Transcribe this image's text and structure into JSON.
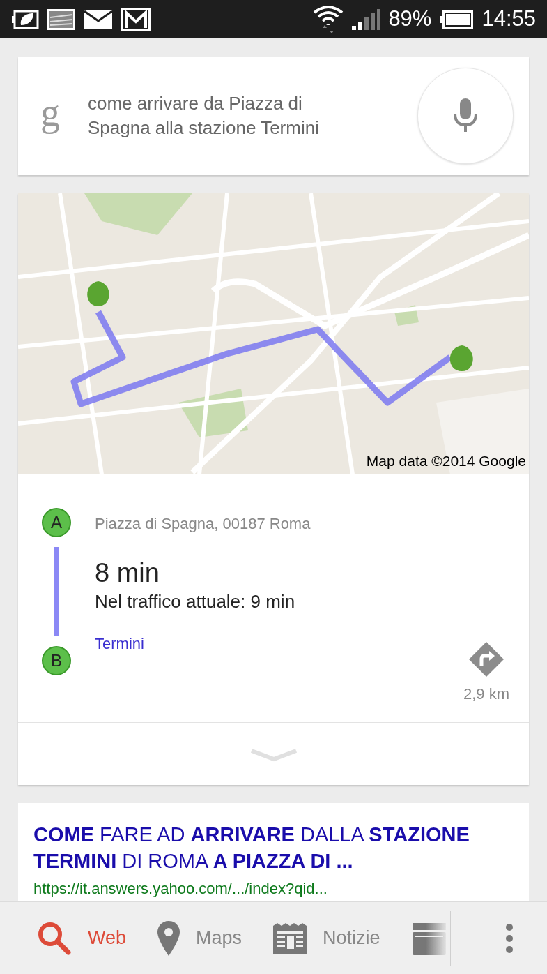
{
  "status_bar": {
    "battery": "89%",
    "time": "14:55"
  },
  "search": {
    "logo": "g",
    "query": "come arrivare da Piazza di Spagna alla stazione Termini"
  },
  "directions": {
    "map_attribution": "Map data ©2014 Google",
    "origin": {
      "marker": "A",
      "address": "Piazza di Spagna, 00187 Roma"
    },
    "duration": "8 min",
    "traffic": "Nel traffico attuale: 9 min",
    "destination": {
      "marker": "B",
      "name": "Termini"
    },
    "distance": "2,9 km"
  },
  "result": {
    "title": "**COME** FARE AD **ARRIVARE** DALLA **STAZIONE TERMINI** DI ROMA **A PIAZZA DI ...**",
    "url": "https://it.answers.yahoo.com/.../index?qid..."
  },
  "bottom_nav": [
    {
      "kind": "search",
      "label": "Web",
      "selected": true
    },
    {
      "kind": "pin",
      "label": "Maps",
      "selected": false
    },
    {
      "kind": "news",
      "label": "Notizie",
      "selected": false
    },
    {
      "kind": "video",
      "selected": false
    }
  ]
}
